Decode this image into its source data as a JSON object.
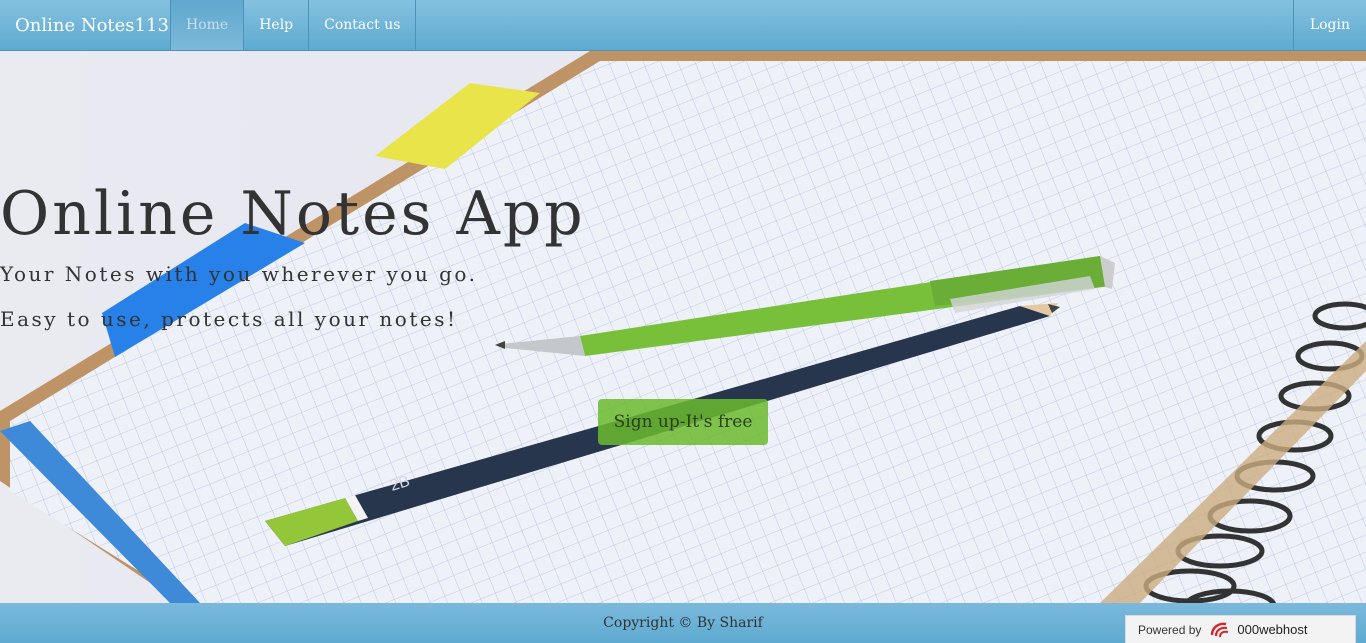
{
  "navbar": {
    "brand": "Online Notes113",
    "items": [
      {
        "label": "Home",
        "active": true
      },
      {
        "label": "Help",
        "active": false
      },
      {
        "label": "Contact us",
        "active": false
      }
    ],
    "login": "Login"
  },
  "hero": {
    "title": "Online Notes App",
    "subtitle1": "Your Notes with you wherever you go.",
    "subtitle2": "Easy to use, protects all your notes!",
    "signup_label": "Sign up-It's free"
  },
  "footer": {
    "copyright": "Copyright © By Sharif",
    "powered_label": "Powered by",
    "host_name": "000webhost"
  },
  "colors": {
    "navbar": "#6fb3d8",
    "signup_button": "#6bba2e",
    "footer": "#6fb3d8"
  }
}
